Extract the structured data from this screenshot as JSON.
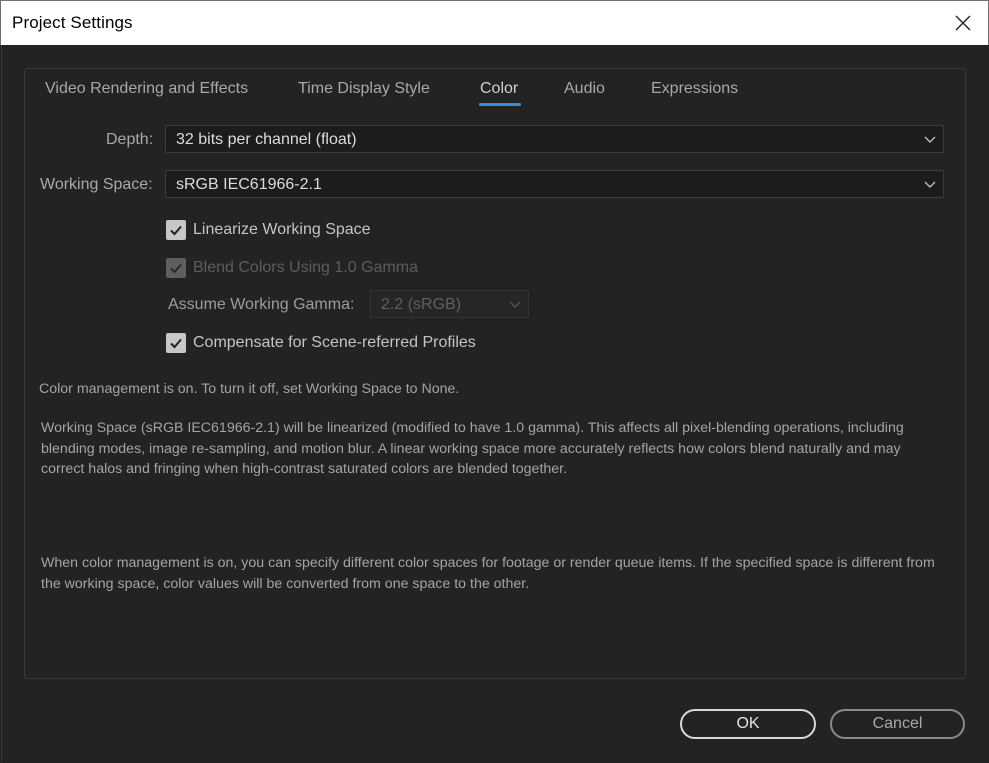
{
  "window": {
    "title": "Project Settings"
  },
  "tabs": [
    {
      "label": "Video Rendering and Effects"
    },
    {
      "label": "Time Display Style"
    },
    {
      "label": "Color"
    },
    {
      "label": "Audio"
    },
    {
      "label": "Expressions"
    }
  ],
  "active_tab": "Color",
  "depth": {
    "label": "Depth:",
    "value": "32 bits per channel (float)"
  },
  "working_space": {
    "label": "Working Space:",
    "value": "sRGB IEC61966-2.1"
  },
  "checkboxes": {
    "linearize": {
      "label": "Linearize Working Space",
      "checked": true,
      "enabled": true
    },
    "blend": {
      "label": "Blend Colors Using 1.0 Gamma",
      "checked": true,
      "enabled": false
    },
    "compensate": {
      "label": "Compensate for Scene-referred Profiles",
      "checked": true,
      "enabled": true
    }
  },
  "gamma": {
    "label": "Assume Working Gamma:",
    "value": "2.2 (sRGB)",
    "enabled": false
  },
  "info": {
    "status": "Color management is on. To turn it off, set Working Space to None.",
    "linearize_note": "Working Space (sRGB IEC61966-2.1) will be linearized (modified to have 1.0 gamma). This affects all pixel-blending operations, including blending modes, image re-sampling, and motion blur. A linear working space more accurately reflects how colors blend naturally and may correct halos and fringing when high-contrast saturated colors are blended together.",
    "conversion_note": "When color management is on, you can specify different color spaces for footage or render queue items. If the specified space is different from the working space, color values will be converted from one space to the other."
  },
  "buttons": {
    "ok": "OK",
    "cancel": "Cancel"
  },
  "colors": {
    "accent": "#2c8fe0",
    "background": "#232323",
    "field": "#1c1c1c"
  }
}
